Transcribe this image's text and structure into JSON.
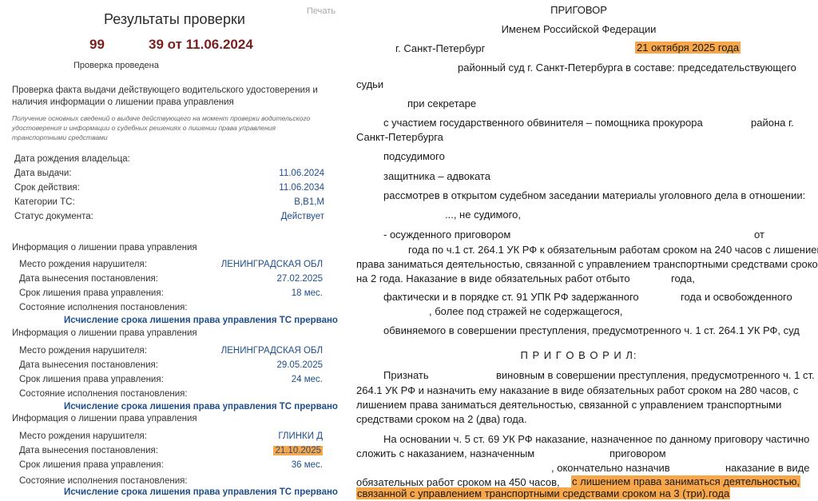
{
  "check": {
    "title": "Результаты проверки",
    "print_label": "Печать",
    "num_a": "99",
    "num_b": "39 от 11.06.2024",
    "done_label": "Проверка проведена",
    "purpose_line1": "Проверка факта выдачи действующего водительского удостоверения и",
    "purpose_line2": "наличия информации о лишении права управления",
    "notice": "Получение основных сведений о выдаче действующего на момент проверки водительского удостоверения и информации о судебных решениях о лишении права управления транспортными средствами",
    "fields": [
      {
        "label": "Дата рождения владельца:",
        "value": ""
      },
      {
        "label": "Дата выдачи:",
        "value": "11.06.2024"
      },
      {
        "label": "Срок действия:",
        "value": "11.06.2034"
      },
      {
        "label": "Категории ТС:",
        "value": "B,B1,M"
      },
      {
        "label": "Статус документа:",
        "value": "Действует"
      }
    ],
    "dep_header": "Информация о лишении права управления",
    "dep_labels": {
      "place": "Место рождения нарушителя:",
      "date": "Дата вынесения постановления:",
      "term": "Срок лишения права управления:",
      "state": "Состояние исполнения постановления:"
    },
    "deprivations": [
      {
        "place": "ЛЕНИНГРАДСКАЯ ОБЛ",
        "date": "27.02.2025",
        "term": "18 мес.",
        "status": "Исчисление срока лишения права управления ТС прервано"
      },
      {
        "place": "ЛЕНИНГРАДСКАЯ ОБЛ",
        "date": "29.05.2025",
        "term": "24 мес.",
        "status": "Исчисление срока лишения права управления ТС прервано"
      },
      {
        "place": "ГЛИНКИ Д",
        "date": "21.10.2025",
        "term": "36 мес.",
        "status": "Исчисление срока лишения права управления ТС прервано"
      }
    ]
  },
  "verdict": {
    "title": "ПРИГОВОР",
    "subtitle": "Именем Российской Федерации",
    "city": "г. Санкт-Петербург",
    "date": "21 октября 2025 года",
    "l_court": "районный суд г. Санкт-Петербурга в составе: председательствующего",
    "l_judge": "судьи",
    "l_secretary": "при секретаре",
    "l_prosecutor_a": "с участием государственного обвинителя – помощника прокурора",
    "l_prosecutor_b": "района г.",
    "l_prosecutor_c": "Санкт-Петербурга",
    "l_defendant": "подсудимого",
    "l_defender": "защитника – адвоката",
    "l_considered": "рассмотрев в открытом судебном заседании материалы уголовного дела в отношении:",
    "l_not_convicted": "..., не судимого,",
    "l_conv_a": "- осужденного приговором",
    "l_conv_b": "от",
    "l_conv_c": "года по ч.1 ст. 264.1 УК РФ к обязательным работам сроком на 240 часов с лишением",
    "l_conv_d": "права заниматься деятельностью, связанной с управлением транспортными средствами сроком",
    "l_conv_e": "на 2 года. Наказание в виде обязательных работ отбыто",
    "l_conv_f": "года,",
    "l_arrest_a": "фактически и в порядке ст. 91 УПК РФ задержанного",
    "l_arrest_b": "года и освобожденного",
    "l_arrest_c": ", более под стражей не содержащегося,",
    "l_accused": "обвиняемого в совершении преступления, предусмотренного ч. 1 ст. 264.1 УК РФ, суд",
    "sentenced": "П Р И Г О В О Р И Л:",
    "p1_a": "Признать",
    "p1_b": "виновным в совершении преступления, предусмотренного ч. 1 ст.",
    "p1_c": "264.1 УК РФ и назначить ему наказание в виде обязательных работ сроком на 280 часов, с",
    "p1_d": "лишением права заниматься деятельностью, связанной с управлением транспортными",
    "p1_e": "средствами сроком на 2 (два) года.",
    "p2_a": "На основании ч. 5 ст. 69 УК РФ наказание, назначенное по данному приговору частично",
    "p2_b": "сложить с наказанием, назначенным",
    "p2_c": "приговором",
    "p2_d": ", окончательно назначив",
    "p2_e": "наказание в виде",
    "p2_f": "обязательных работ сроком на 450 часов,",
    "p2_g": "с лишением права заниматься деятельностью,",
    "p2_h": "связанной с управлением транспортными средствами сроком на 3 (три) года",
    "p2_i": "."
  },
  "colors": {
    "highlight": "#f7a64a",
    "link_blue": "#1f4e8c",
    "number_red": "#7a1f1f"
  }
}
